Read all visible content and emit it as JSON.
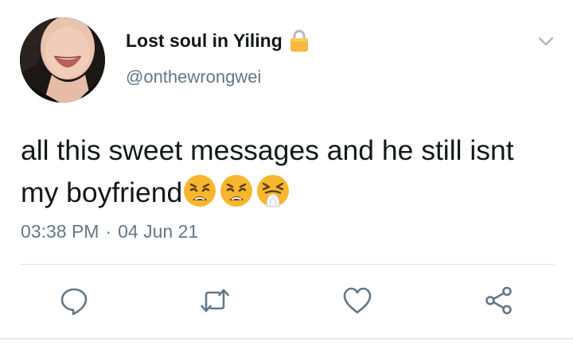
{
  "tweet": {
    "display_name": "Lost soul in Yiling",
    "handle": "@onthewrongwei",
    "text": "all this sweet messages and he still isnt my boyfriend",
    "time": "03:38 PM",
    "separator": "·",
    "date": "04 Jun 21"
  },
  "icons": {
    "lock": "lock-icon",
    "menu": "chevron-down-icon",
    "emojis": [
      "weary-face-emoji",
      "weary-face-emoji",
      "sneezing-face-emoji"
    ],
    "actions": [
      "reply-icon",
      "retweet-icon",
      "like-icon",
      "share-icon"
    ]
  },
  "colors": {
    "text": "#14171a",
    "secondary": "#657786",
    "icon": "#657786",
    "lock": "#f5b942",
    "divider": "#dfe3e7"
  }
}
